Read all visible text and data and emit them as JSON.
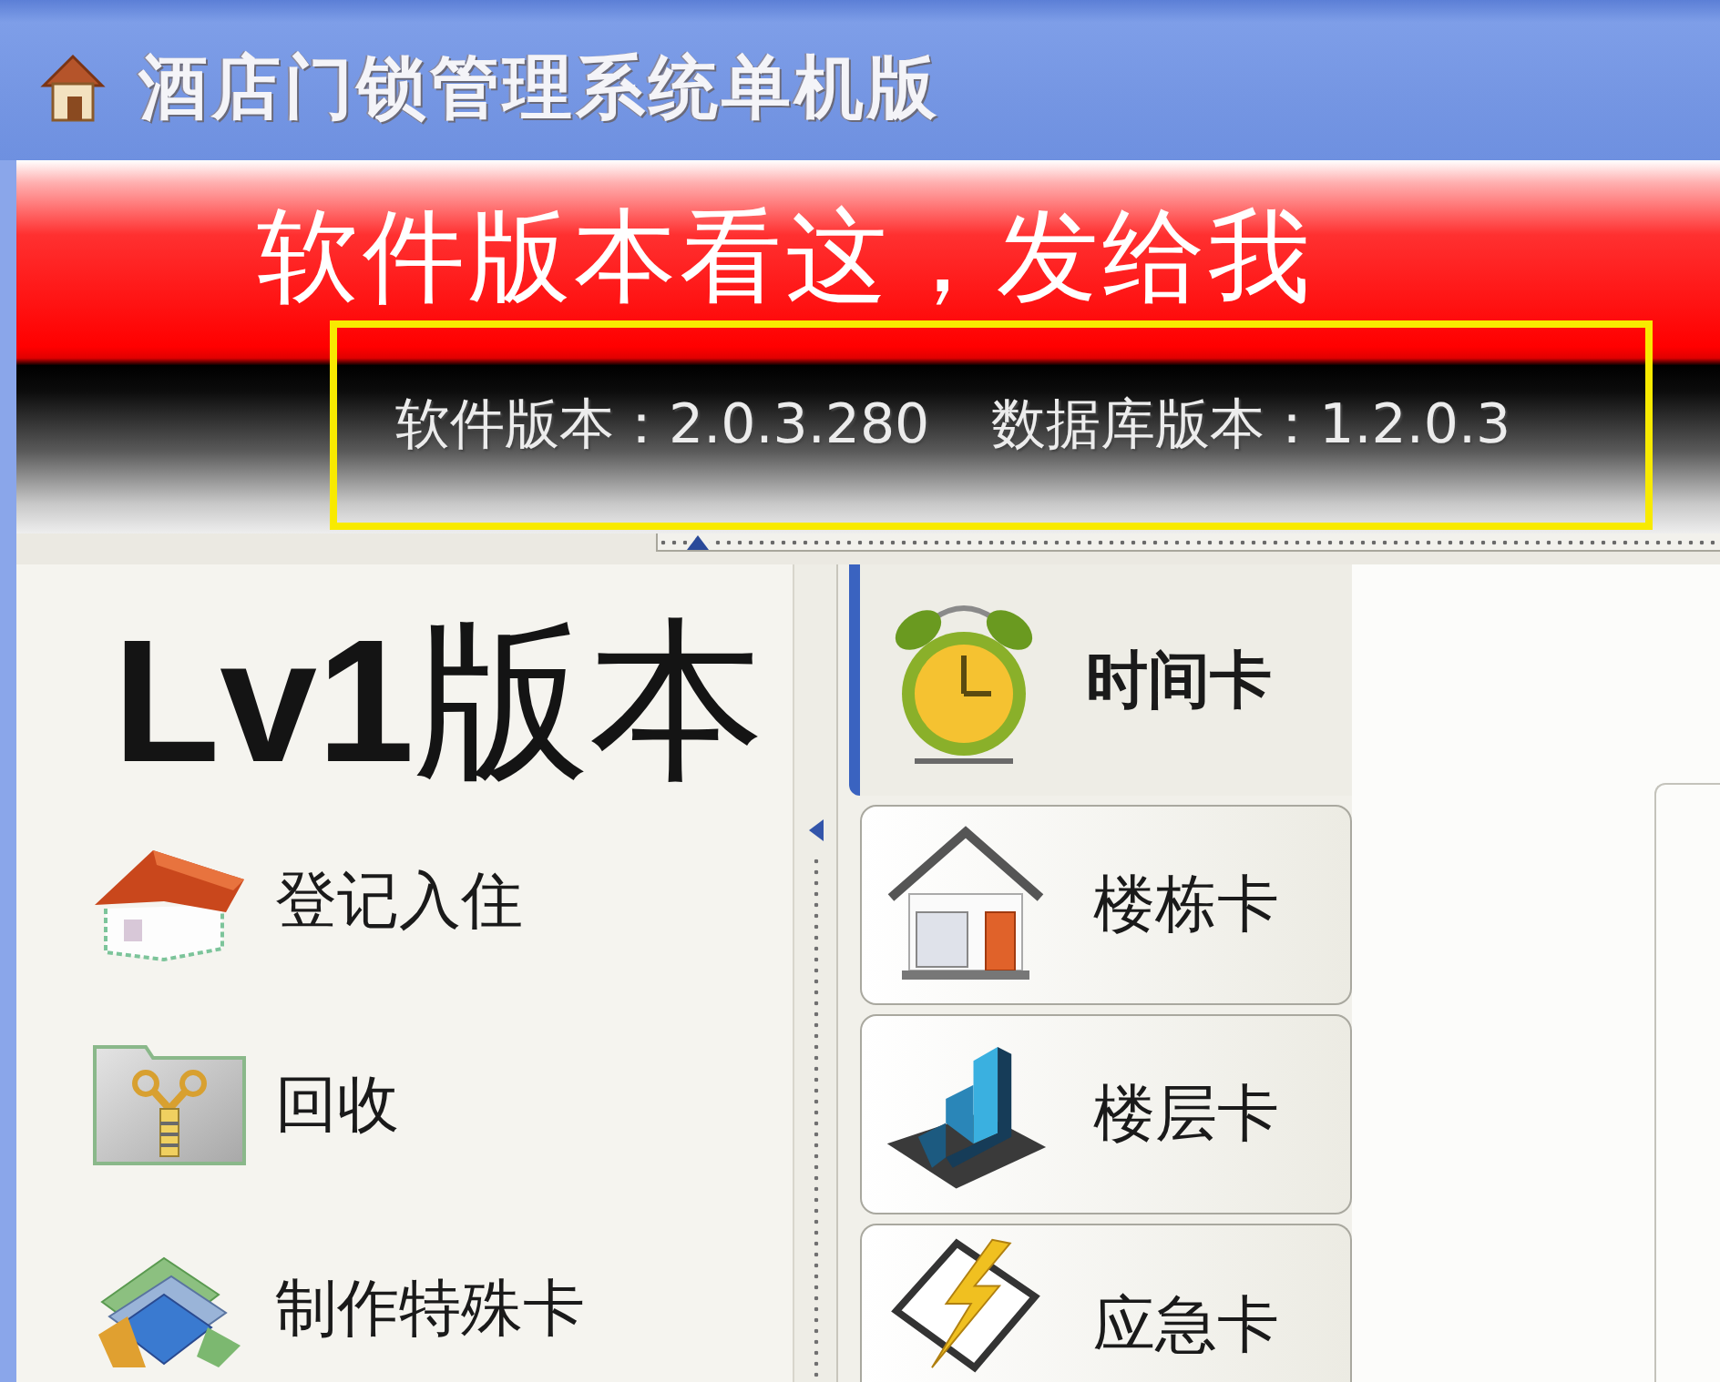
{
  "window": {
    "title": "酒店门锁管理系统单机版"
  },
  "banner": {
    "caption": "软件版本看这，发给我"
  },
  "version_info": {
    "highlighted": true,
    "software_version": "软件版本：2.0.3.280",
    "database_version": "数据库版本：1.2.0.3"
  },
  "sidebar": {
    "label": "**Lv1**版本",
    "items": [
      {
        "label": "登记入住"
      },
      {
        "label": "回收"
      },
      {
        "label": "制作特殊卡"
      }
    ]
  },
  "card_tabs": [
    {
      "label": "时间卡",
      "selected": true
    },
    {
      "label": "楼栋卡",
      "selected": false
    },
    {
      "label": "楼层卡",
      "selected": false
    },
    {
      "label": "应急卡",
      "selected": false
    }
  ]
}
